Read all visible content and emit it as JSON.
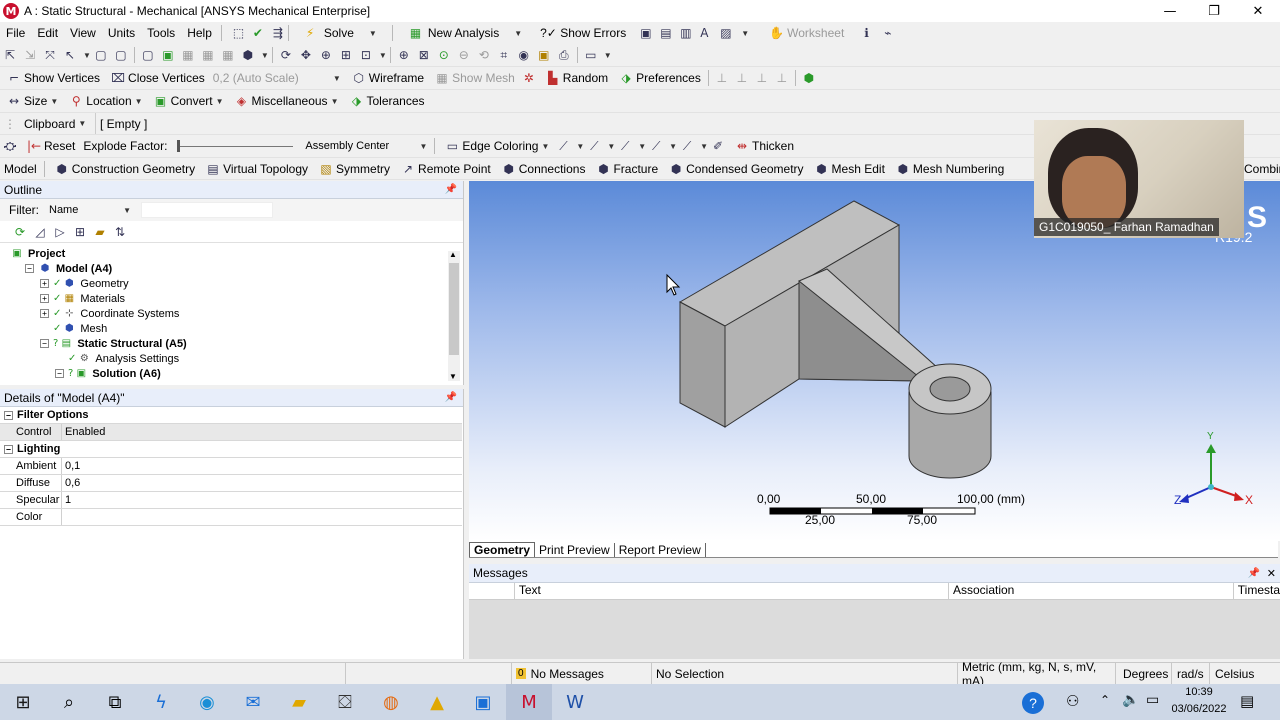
{
  "window": {
    "title": "A : Static Structural - Mechanical [ANSYS Mechanical Enterprise]",
    "minimize": "—",
    "maximize": "❐",
    "close": "✕"
  },
  "menu": [
    "File",
    "Edit",
    "View",
    "Units",
    "Tools",
    "Help"
  ],
  "toolbar1": {
    "solve": "Solve",
    "new_analysis": "New Analysis",
    "show_errors": "?✓ Show Errors",
    "worksheet": "Worksheet"
  },
  "toolbar3": {
    "show_vertices": "Show Vertices",
    "close_vertices": "Close Vertices",
    "scale": "0,2 (Auto Scale)",
    "wireframe": "Wireframe",
    "show_mesh": "Show Mesh",
    "random": "Random",
    "preferences": "Preferences"
  },
  "toolbar4": {
    "size": "Size",
    "location": "Location",
    "convert": "Convert",
    "misc": "Miscellaneous",
    "tolerances": "Tolerances"
  },
  "toolbar5": {
    "clipboard": "Clipboard",
    "empty": "[ Empty ]"
  },
  "toolbar6": {
    "reset": "Reset",
    "explode_label": "Explode Factor:",
    "assembly": "Assembly Center",
    "edge_coloring": "Edge Coloring",
    "thicken": "Thicken"
  },
  "context_toolbar": [
    "Model",
    "Construction Geometry",
    "Virtual Topology",
    "Symmetry",
    "Remote Point",
    "Connections",
    "Fracture",
    "Condensed Geometry",
    "Mesh Edit",
    "Mesh Numbering",
    "Combin"
  ],
  "outline": {
    "title": "Outline",
    "filter_label": "Filter:",
    "filter_value": "Name",
    "tree": [
      {
        "label": "Project",
        "level": 0,
        "bold": true,
        "icon": "project-icon"
      },
      {
        "label": "Model (A4)",
        "level": 1,
        "bold": true,
        "icon": "model-icon"
      },
      {
        "label": "Geometry",
        "level": 2,
        "bold": false,
        "icon": "geometry-icon"
      },
      {
        "label": "Materials",
        "level": 2,
        "bold": false,
        "icon": "materials-icon"
      },
      {
        "label": "Coordinate Systems",
        "level": 2,
        "bold": false,
        "icon": "coordinate-icon"
      },
      {
        "label": "Mesh",
        "level": 2,
        "bold": false,
        "icon": "mesh-icon"
      },
      {
        "label": "Static Structural (A5)",
        "level": 2,
        "bold": true,
        "icon": "static-structural-icon"
      },
      {
        "label": "Analysis Settings",
        "level": 3,
        "bold": false,
        "icon": "analysis-settings-icon"
      },
      {
        "label": "Solution (A6)",
        "level": 3,
        "bold": true,
        "icon": "solution-icon"
      }
    ]
  },
  "details": {
    "title": "Details of \"Model (A4)\"",
    "groups": [
      {
        "name": "Filter Options",
        "rows": [
          {
            "label": "Control",
            "value": "Enabled"
          }
        ]
      },
      {
        "name": "Lighting",
        "rows": [
          {
            "label": "Ambient",
            "value": "0,1"
          },
          {
            "label": "Diffuse",
            "value": "0,6"
          },
          {
            "label": "Specular",
            "value": "1"
          },
          {
            "label": "Color",
            "value": ""
          }
        ]
      }
    ]
  },
  "viewport": {
    "brand": "S",
    "version": "R19.2",
    "webcam_name": "G1C019050_ Farhan Ramadhan",
    "scale_top": [
      "0,00",
      "50,00",
      "100,00 (mm)"
    ],
    "scale_bottom": [
      "25,00",
      "75,00"
    ],
    "axis_labels": {
      "x": "X",
      "y": "Y",
      "z": "Z"
    },
    "tabs": [
      "Geometry",
      "Print Preview",
      "Report Preview"
    ]
  },
  "messages": {
    "title": "Messages",
    "columns": [
      "Text",
      "Association",
      "Timesta"
    ]
  },
  "statusbar": {
    "messages": "No Messages",
    "message_count": "0",
    "selection": "No Selection",
    "units": "Metric (mm, kg, N, s, mV, mA)",
    "degrees": "Degrees",
    "rads": "rad/s",
    "temp": "Celsius"
  },
  "taskbar": {
    "time": "10:39",
    "date": "03/06/2022"
  },
  "colors": {
    "viewport_top": "#5b8ad8",
    "viewport_bottom": "#ffffff",
    "panel_header": "#e8eefa",
    "taskbar": "#cdd7e6"
  }
}
